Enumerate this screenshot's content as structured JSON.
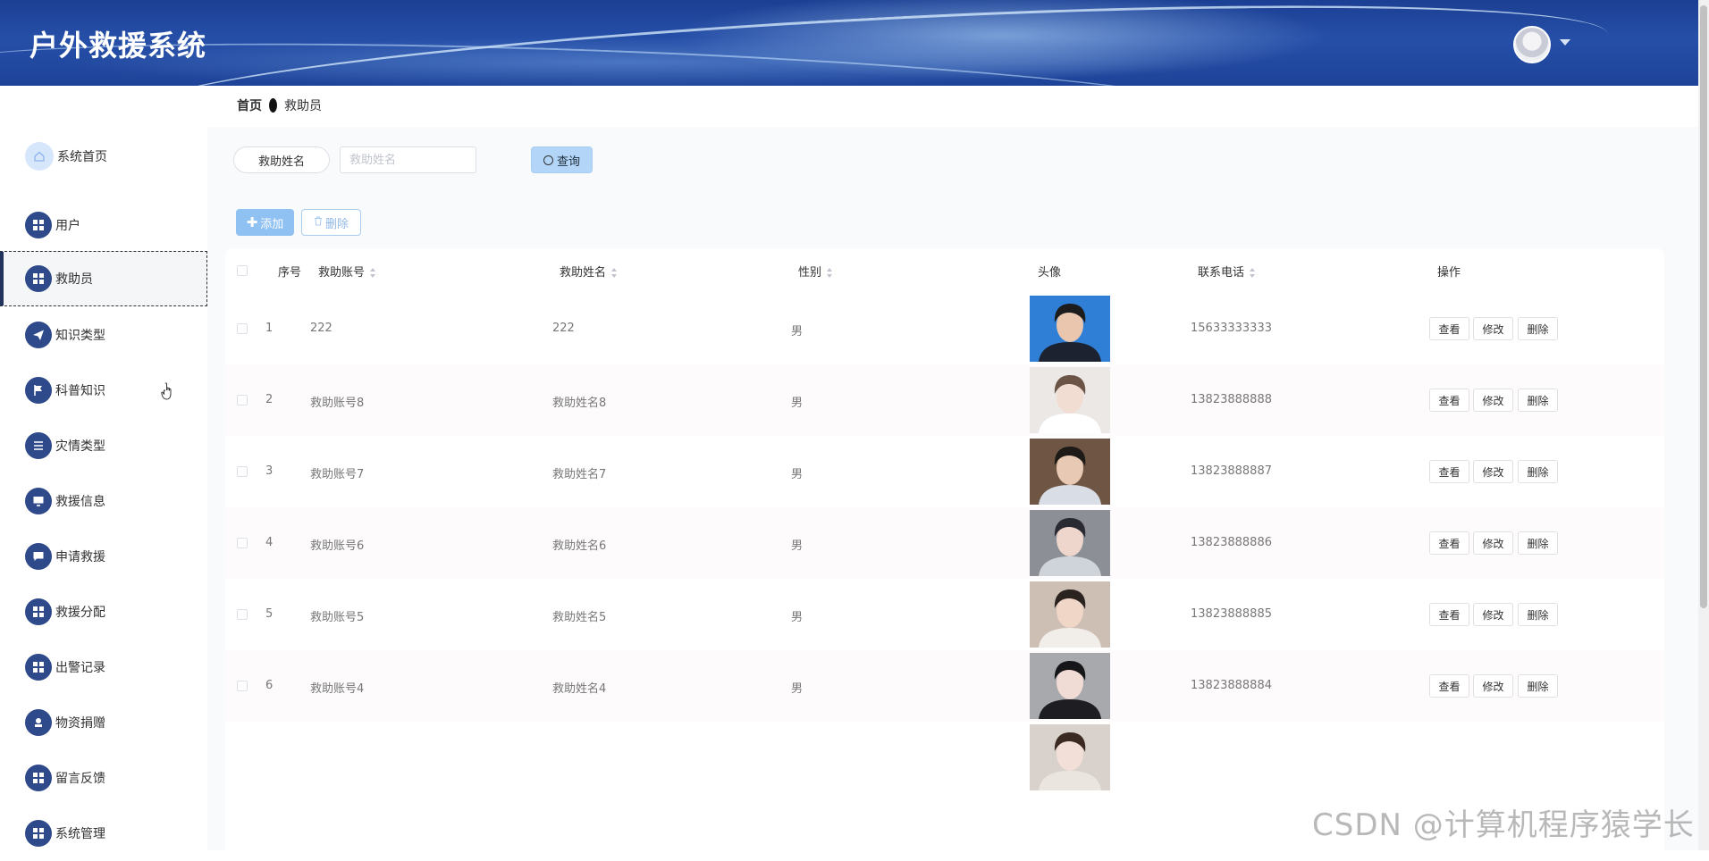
{
  "header": {
    "app_title": "户外救援系统",
    "avatar_icon": "user-avatar",
    "menu_caret_icon": "caret-down-icon"
  },
  "breadcrumb": {
    "home": "首页",
    "current": "救助员"
  },
  "sidebar": {
    "items": [
      {
        "label": "系统首页",
        "icon": "home-icon"
      },
      {
        "label": "用户",
        "icon": "grid-icon"
      },
      {
        "label": "救助员",
        "icon": "grid-icon",
        "active": true
      },
      {
        "label": "知识类型",
        "icon": "paper-plane-icon"
      },
      {
        "label": "科普知识",
        "icon": "flag-icon"
      },
      {
        "label": "灾情类型",
        "icon": "list-icon"
      },
      {
        "label": "救援信息",
        "icon": "monitor-icon"
      },
      {
        "label": "申请救援",
        "icon": "chat-icon"
      },
      {
        "label": "救援分配",
        "icon": "grid-icon"
      },
      {
        "label": "出警记录",
        "icon": "grid-icon"
      },
      {
        "label": "物资捐赠",
        "icon": "stamp-icon"
      },
      {
        "label": "留言反馈",
        "icon": "grid-icon"
      },
      {
        "label": "系统管理",
        "icon": "grid-icon"
      }
    ]
  },
  "search": {
    "label": "救助姓名",
    "placeholder": "救助姓名",
    "value": "",
    "query_label": "查询",
    "query_icon": "search-icon"
  },
  "toolbar": {
    "add_label": "添加",
    "add_icon": "plus-icon",
    "delete_label": "删除",
    "delete_icon": "trash-icon"
  },
  "table": {
    "headers": {
      "index": "序号",
      "account": "救助账号",
      "name": "救助姓名",
      "gender": "性别",
      "photo": "头像",
      "phone": "联系电话",
      "actions": "操作"
    },
    "action_labels": {
      "view": "查看",
      "edit": "修改",
      "delete": "删除"
    },
    "rows": [
      {
        "index": "1",
        "account": "222",
        "name": "222",
        "gender": "男",
        "phone": "15633333333",
        "photo_colors": {
          "bg": "#2f7fd6",
          "face": "#e9c6ad",
          "hair": "#1c1c1c",
          "body": "#1d2230"
        }
      },
      {
        "index": "2",
        "account": "救助账号8",
        "name": "救助姓名8",
        "gender": "男",
        "phone": "13823888888",
        "photo_colors": {
          "bg": "#ece8e6",
          "face": "#f2ddd3",
          "hair": "#6b5446",
          "body": "#ffffff"
        }
      },
      {
        "index": "3",
        "account": "救助账号7",
        "name": "救助姓名7",
        "gender": "男",
        "phone": "13823888887",
        "photo_colors": {
          "bg": "#6e5544",
          "face": "#e8c9b3",
          "hair": "#1e1a18",
          "body": "#d9dde6"
        }
      },
      {
        "index": "4",
        "account": "救助账号6",
        "name": "救助姓名6",
        "gender": "男",
        "phone": "13823888886",
        "photo_colors": {
          "bg": "#8d8f96",
          "face": "#eed6cd",
          "hair": "#2a2a33",
          "body": "#cfd3da"
        }
      },
      {
        "index": "5",
        "account": "救助账号5",
        "name": "救助姓名5",
        "gender": "男",
        "phone": "13823888885",
        "photo_colors": {
          "bg": "#cdbfb4",
          "face": "#efd6c7",
          "hair": "#2b2320",
          "body": "#f1ede9"
        }
      },
      {
        "index": "6",
        "account": "救助账号4",
        "name": "救助姓名4",
        "gender": "男",
        "phone": "13823888884",
        "photo_colors": {
          "bg": "#a8a9ad",
          "face": "#f0dcd4",
          "hair": "#161618",
          "body": "#1d1d22"
        }
      },
      {
        "index": "",
        "account": "",
        "name": "",
        "gender": "",
        "phone": "",
        "photo_colors": {
          "bg": "#d9d2cc",
          "face": "#f2e0d8",
          "hair": "#3a2a22",
          "body": "#ebe5e0"
        }
      }
    ]
  },
  "watermark": "CSDN @计算机程序猿学长"
}
